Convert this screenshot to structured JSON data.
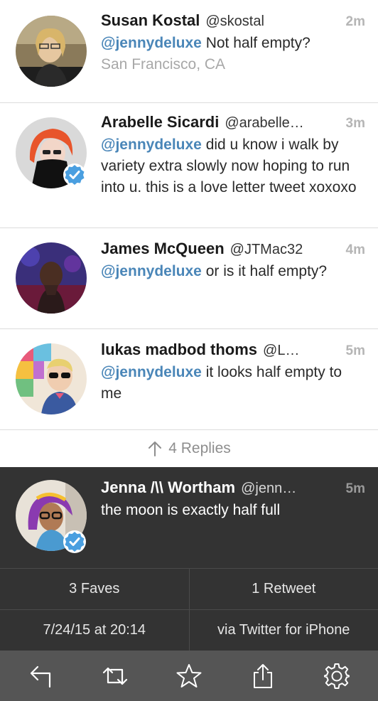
{
  "tweets": [
    {
      "name": "Susan Kostal",
      "handle": "@skostal",
      "time": "2m",
      "mention": "@jennydeluxe",
      "text": " Not half empty?",
      "location": "San Francisco, CA",
      "verified": false
    },
    {
      "name": "Arabelle Sicardi",
      "handle": "@arabelle…",
      "time": "3m",
      "mention": "@jennydeluxe",
      "text": " did u know i walk by variety extra slowly now hoping to run into u. this is a love letter tweet xoxoxo",
      "verified": true
    },
    {
      "name": "James McQueen",
      "handle": "@JTMac32",
      "time": "4m",
      "mention": "@jennydeluxe",
      "text": " or is it half empty?",
      "verified": false
    },
    {
      "name": "lukas madbod thoms",
      "handle": "@L…",
      "time": "5m",
      "mention": "@jennydeluxe",
      "text": " it looks half empty to me",
      "verified": false
    }
  ],
  "replies": {
    "label": "4 Replies",
    "icon": "arrow-up-icon"
  },
  "focused": {
    "name": "Jenna /\\\\ Wortham",
    "handle": "@jenn…",
    "time": "5m",
    "text": "the moon is exactly half full",
    "verified": true,
    "faves": "3 Faves",
    "retweets": "1 Retweet",
    "date": "7/24/15 at 20:14",
    "via": "via Twitter for iPhone"
  },
  "toolbar": {
    "icons": [
      "reply-icon",
      "retweet-icon",
      "favorite-star-icon",
      "share-icon",
      "settings-gear-icon"
    ]
  },
  "colors": {
    "mention": "#4a86b8",
    "verified": "#4a9fe0",
    "dark_panel": "#333333",
    "toolbar": "#555555"
  }
}
